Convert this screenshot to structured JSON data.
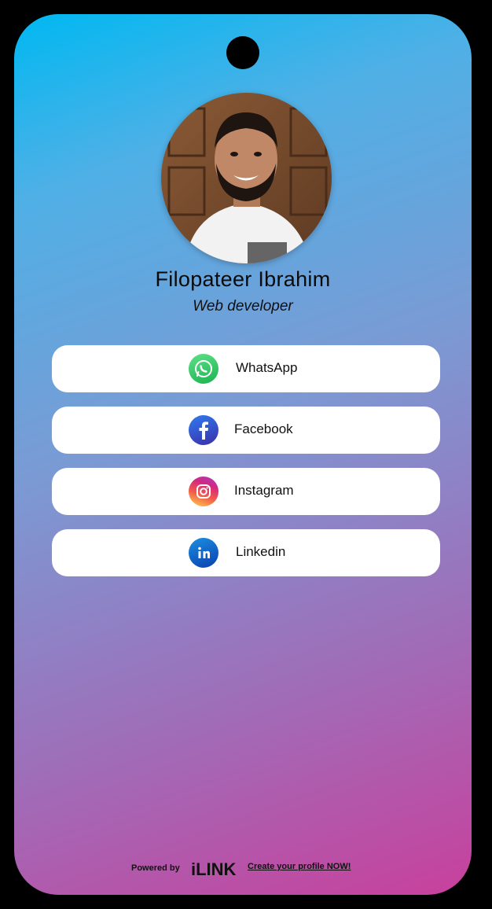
{
  "profile": {
    "name": "Filopateer Ibrahim",
    "title": "Web developer"
  },
  "links": [
    {
      "label": "WhatsApp",
      "icon": "whatsapp-icon",
      "color": "#25d366"
    },
    {
      "label": "Facebook",
      "icon": "facebook-icon",
      "color": "#1877f2"
    },
    {
      "label": "Instagram",
      "icon": "instagram-icon",
      "color": "#e1306c"
    },
    {
      "label": "Linkedin",
      "icon": "linkedin-icon",
      "color": "#0a66c2"
    }
  ],
  "footer": {
    "powered_by": "Powered by",
    "brand": "iLINK",
    "cta": "Create your profile NOW!"
  },
  "colors": {
    "gradient_start": "#00b8f1",
    "gradient_end": "#c8409c"
  }
}
